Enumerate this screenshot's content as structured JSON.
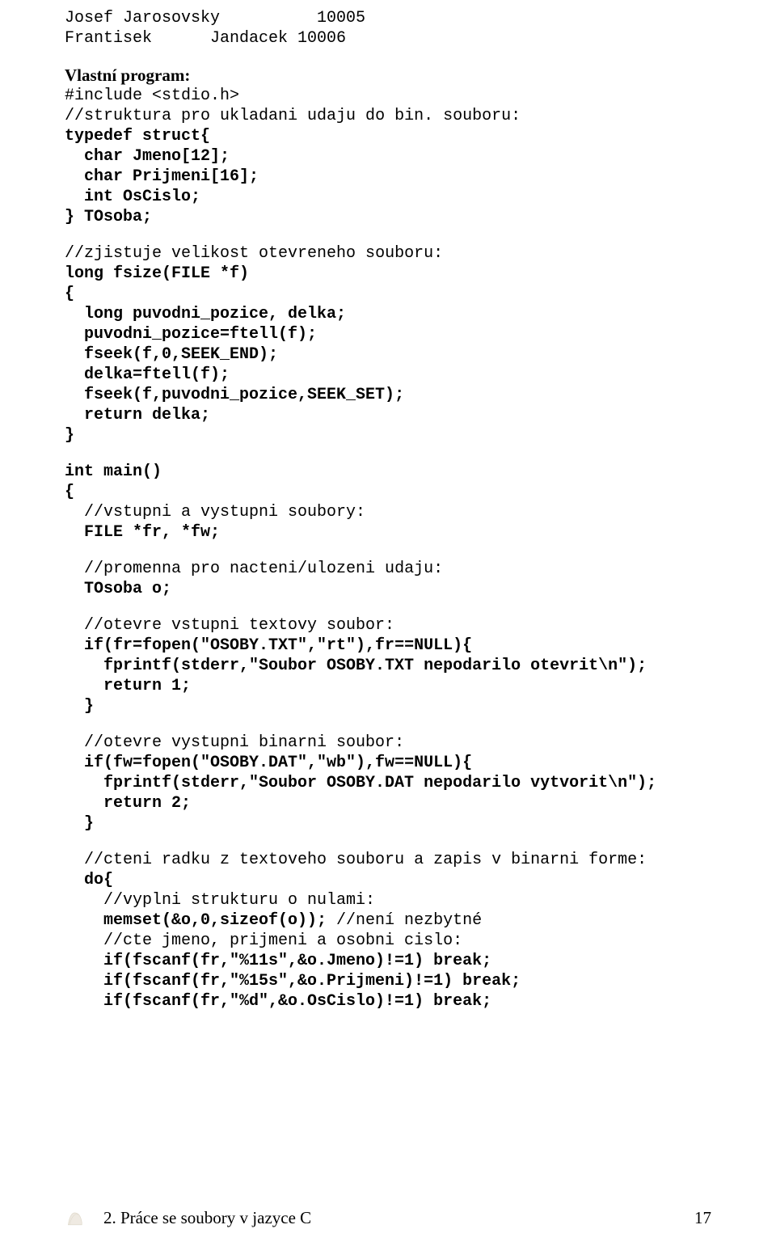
{
  "header_rows": [
    "Josef Jarosovsky          10005",
    "Frantisek      Jandacek 10006"
  ],
  "section_title": "Vlastní program:",
  "code": {
    "l1": "#include <stdio.h>",
    "l2": "//struktura pro ukladani udaju do bin. souboru:",
    "l3": "typedef struct{",
    "l4": "char Jmeno[12];",
    "l5": "char Prijmeni[16];",
    "l6": "int OsCislo;",
    "l7": "} TOsoba;",
    "l8": "//zjistuje velikost otevreneho souboru:",
    "l9": "long fsize(FILE *f)",
    "l10": "{",
    "l11": "long puvodni_pozice, delka;",
    "l12": "puvodni_pozice=ftell(f);",
    "l13": "fseek(f,0,SEEK_END);",
    "l14": "delka=ftell(f);",
    "l15": "fseek(f,puvodni_pozice,SEEK_SET);",
    "l16": "return delka;",
    "l17": "}",
    "l18": "int main()",
    "l19": "{",
    "l20": "//vstupni a vystupni soubory:",
    "l21": "FILE *fr, *fw;",
    "l22": "//promenna pro nacteni/ulozeni udaju:",
    "l23": "TOsoba o;",
    "l24": "//otevre vstupni textovy soubor:",
    "l25": "if(fr=fopen(\"OSOBY.TXT\",\"rt\"),fr==NULL){",
    "l26": "fprintf(stderr,\"Soubor OSOBY.TXT nepodarilo otevrit\\n\");",
    "l27": "return 1;",
    "l28": "}",
    "l29": "//otevre vystupni binarni soubor:",
    "l30": "if(fw=fopen(\"OSOBY.DAT\",\"wb\"),fw==NULL){",
    "l31": "fprintf(stderr,\"Soubor OSOBY.DAT nepodarilo vytvorit\\n\");",
    "l32": "return 2;",
    "l33": "}",
    "l34": "//cteni radku z textoveho souboru a zapis v binarni forme:",
    "l35": "do{",
    "l36": "//vyplni strukturu o nulami:",
    "l37a": "memset(&o,0,sizeof(o)); ",
    "l37b": "//není nezbytné",
    "l38": "//cte jmeno, prijmeni a osobni cislo:",
    "l39": "if(fscanf(fr,\"%11s\",&o.Jmeno)!=1) break;",
    "l40": "if(fscanf(fr,\"%15s\",&o.Prijmeni)!=1) break;",
    "l41": "if(fscanf(fr,\"%d\",&o.OsCislo)!=1) break;"
  },
  "footer": {
    "text": "2. Práce se soubory v jazyce C",
    "page": "17"
  }
}
